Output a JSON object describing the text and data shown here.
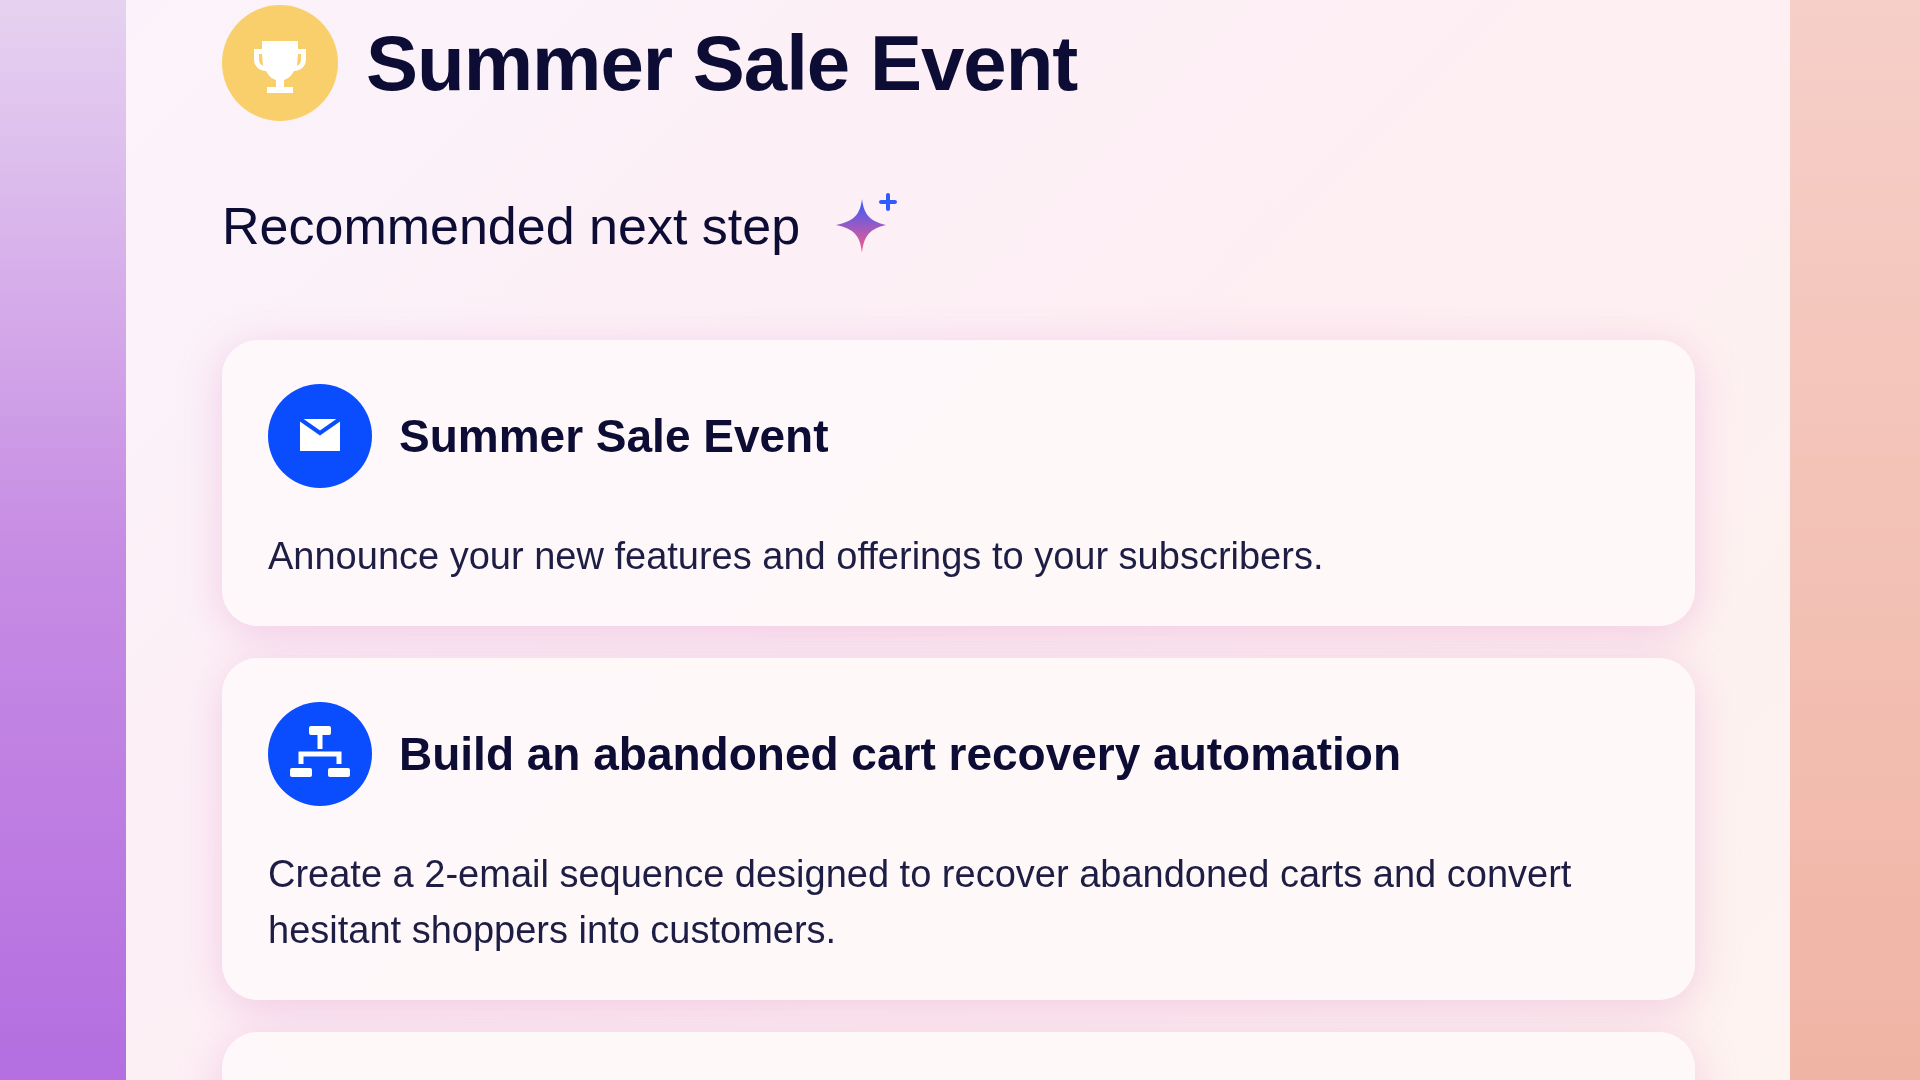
{
  "header": {
    "title": "Summer Sale Event"
  },
  "section": {
    "title": "Recommended next step"
  },
  "recommendations": [
    {
      "kind": "email",
      "title": "Summer Sale Event",
      "description": "Announce your new features and offerings to your subscribers."
    },
    {
      "kind": "automation",
      "title": "Build an abandoned cart recovery automation",
      "description": "Create a 2-email sequence designed to recover abandoned carts and convert hesitant shoppers into customers."
    }
  ]
}
